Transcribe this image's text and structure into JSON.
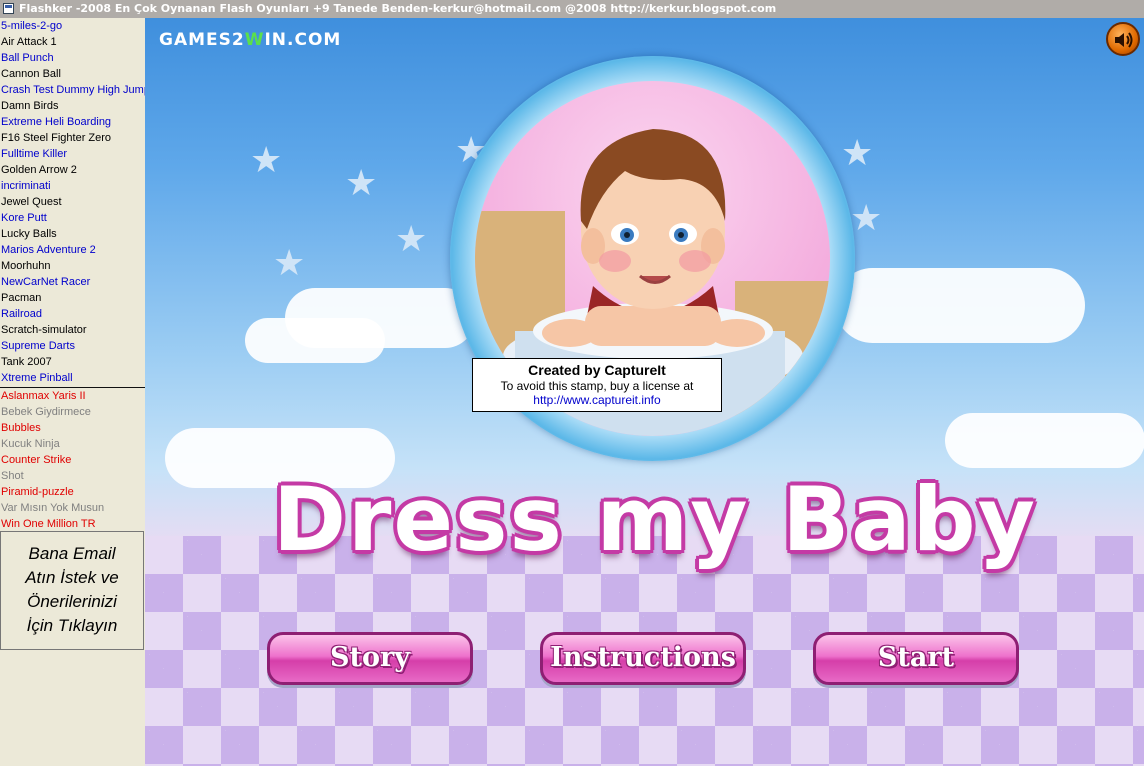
{
  "window": {
    "title": "Flashker -2008 En Çok Oynanan Flash Oyunları +9 Tanede Benden-kerkur@hotmail.com @2008 http://kerkur.blogspot.com"
  },
  "sidebar": {
    "games": [
      {
        "label": "5-miles-2-go",
        "color": "#0000cc"
      },
      {
        "label": "Air Attack 1",
        "color": "#000000"
      },
      {
        "label": "Ball Punch",
        "color": "#0000cc"
      },
      {
        "label": "Cannon Ball",
        "color": "#000000"
      },
      {
        "label": "Crash Test Dummy High Jump",
        "color": "#0000cc"
      },
      {
        "label": "Damn Birds",
        "color": "#000000"
      },
      {
        "label": "Extreme Heli Boarding",
        "color": "#0000cc"
      },
      {
        "label": "F16 Steel Fighter Zero",
        "color": "#000000"
      },
      {
        "label": "Fulltime Killer",
        "color": "#0000cc"
      },
      {
        "label": "Golden Arrow 2",
        "color": "#000000"
      },
      {
        "label": "incriminati",
        "color": "#0000cc"
      },
      {
        "label": "Jewel Quest",
        "color": "#000000"
      },
      {
        "label": "Kore Putt",
        "color": "#0000cc"
      },
      {
        "label": "Lucky Balls",
        "color": "#000000"
      },
      {
        "label": "Marios Adventure 2",
        "color": "#0000cc"
      },
      {
        "label": "Moorhuhn",
        "color": "#000000"
      },
      {
        "label": "NewCarNet Racer",
        "color": "#0000cc"
      },
      {
        "label": "Pacman",
        "color": "#000000"
      },
      {
        "label": "Railroad",
        "color": "#0000cc"
      },
      {
        "label": "Scratch-simulator",
        "color": "#000000"
      },
      {
        "label": "Supreme Darts",
        "color": "#0000cc"
      },
      {
        "label": "Tank 2007",
        "color": "#000000"
      },
      {
        "label": " Xtreme Pinball",
        "color": "#0000cc"
      }
    ],
    "extra_games": [
      {
        "label": "Aslanmax Yaris II",
        "color": "#e00000"
      },
      {
        "label": "Bebek Giydirmece",
        "color": "#808080"
      },
      {
        "label": "Bubbles",
        "color": "#e00000"
      },
      {
        "label": "Kucuk Ninja",
        "color": "#808080"
      },
      {
        "label": "Counter Strike",
        "color": "#e00000"
      },
      {
        "label": "Shot",
        "color": "#808080"
      },
      {
        "label": "Piramid-puzzle",
        "color": "#e00000"
      },
      {
        "label": "Var Mısın Yok Musun",
        "color": "#808080"
      },
      {
        "label": "Win One Million TR",
        "color": "#e00000"
      }
    ],
    "mail_box": {
      "lines": [
        "Bana   Email",
        "Atın İstek ve",
        "Önerilerinizi",
        "İçin Tıklayın"
      ]
    }
  },
  "game": {
    "logo_part1": "GAMES2",
    "logo_part2": "W",
    "logo_part3": "IN.COM",
    "title": "Dress my Baby",
    "watermark": {
      "line1": "Created by CaptureIt",
      "line2": "To avoid this stamp, buy a license at",
      "link": "http://www.captureit.info"
    },
    "buttons": {
      "story": "Story",
      "instructions": "Instructions",
      "start": "Start"
    }
  },
  "icons": {
    "sound": "speaker-icon",
    "window": "app-window-icon"
  }
}
